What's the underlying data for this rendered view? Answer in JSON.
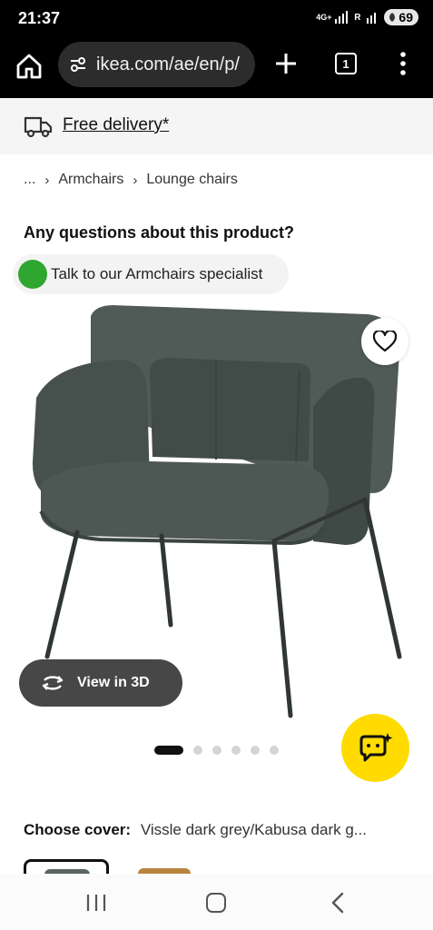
{
  "status_bar": {
    "time": "21:37",
    "network": "4G+",
    "roaming": "R",
    "battery": "69"
  },
  "browser": {
    "url": "ikea.com/ae/en/p/",
    "tab_count": "1"
  },
  "delivery_banner": {
    "text": "Free delivery*"
  },
  "breadcrumb": {
    "items": [
      "...",
      "Armchairs",
      "Lounge chairs"
    ]
  },
  "questions": {
    "heading": "Any questions about this product?",
    "specialist_label": "Talk to our Armchairs specialist"
  },
  "product": {
    "view3d_label": "View in 3D",
    "carousel": {
      "total": 6,
      "active_index": 0
    }
  },
  "cover": {
    "label": "Choose cover:",
    "value": "Vissle dark grey/Kabusa dark g..."
  },
  "colors": {
    "chat_button": "#ffdb00",
    "specialist_dot": "#2fa62f",
    "chair": "#4a5550"
  }
}
